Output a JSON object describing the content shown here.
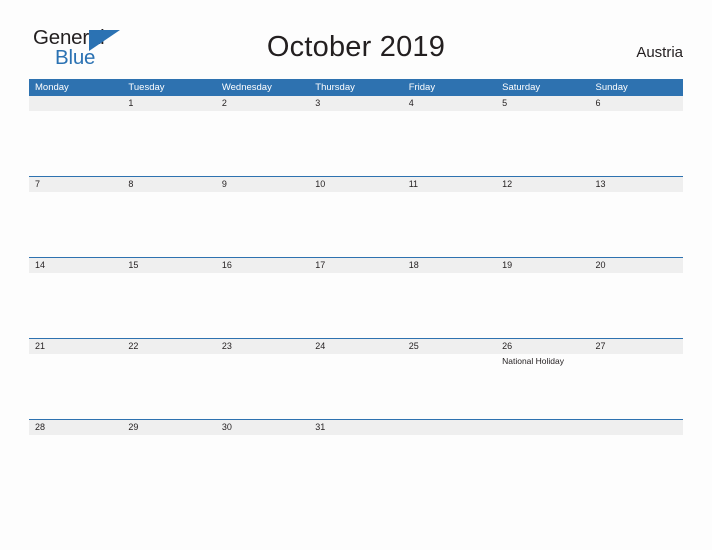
{
  "brand": {
    "name_part1": "General",
    "name_part2": "Blue",
    "triangle_icon": "triangle-flag-icon",
    "color_dark": "#231f20",
    "color_blue": "#2b72b3"
  },
  "header": {
    "title": "October 2019",
    "country": "Austria"
  },
  "theme": {
    "header_blue": "#2e72b0",
    "date_strip_gray": "#efefef",
    "page_background": "#fdfdfd",
    "text_color": "#231f20"
  },
  "calendar": {
    "month": "October",
    "year": "2019",
    "weekday_headers": [
      "Monday",
      "Tuesday",
      "Wednesday",
      "Thursday",
      "Friday",
      "Saturday",
      "Sunday"
    ],
    "weeks": [
      {
        "days": [
          {
            "date": "",
            "events": []
          },
          {
            "date": "1",
            "events": []
          },
          {
            "date": "2",
            "events": []
          },
          {
            "date": "3",
            "events": []
          },
          {
            "date": "4",
            "events": []
          },
          {
            "date": "5",
            "events": []
          },
          {
            "date": "6",
            "events": []
          }
        ]
      },
      {
        "days": [
          {
            "date": "7",
            "events": []
          },
          {
            "date": "8",
            "events": []
          },
          {
            "date": "9",
            "events": []
          },
          {
            "date": "10",
            "events": []
          },
          {
            "date": "11",
            "events": []
          },
          {
            "date": "12",
            "events": []
          },
          {
            "date": "13",
            "events": []
          }
        ]
      },
      {
        "days": [
          {
            "date": "14",
            "events": []
          },
          {
            "date": "15",
            "events": []
          },
          {
            "date": "16",
            "events": []
          },
          {
            "date": "17",
            "events": []
          },
          {
            "date": "18",
            "events": []
          },
          {
            "date": "19",
            "events": []
          },
          {
            "date": "20",
            "events": []
          }
        ]
      },
      {
        "days": [
          {
            "date": "21",
            "events": []
          },
          {
            "date": "22",
            "events": []
          },
          {
            "date": "23",
            "events": []
          },
          {
            "date": "24",
            "events": []
          },
          {
            "date": "25",
            "events": []
          },
          {
            "date": "26",
            "events": [
              "National Holiday"
            ]
          },
          {
            "date": "27",
            "events": []
          }
        ]
      },
      {
        "days": [
          {
            "date": "28",
            "events": []
          },
          {
            "date": "29",
            "events": []
          },
          {
            "date": "30",
            "events": []
          },
          {
            "date": "31",
            "events": []
          },
          {
            "date": "",
            "events": []
          },
          {
            "date": "",
            "events": []
          },
          {
            "date": "",
            "events": []
          }
        ]
      }
    ]
  }
}
